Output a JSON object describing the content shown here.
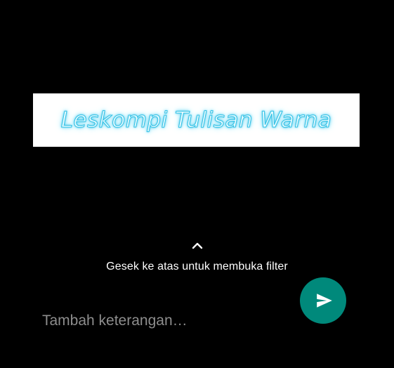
{
  "media_preview": {
    "text": "Leskompi Tulisan Warna",
    "text_color": "#38c3e6",
    "background": "#ffffff"
  },
  "swipe_hint": {
    "icon": "chevron-up-icon",
    "label": "Gesek ke atas untuk membuka filter"
  },
  "caption": {
    "placeholder": "Tambah keterangan…",
    "value": ""
  },
  "send_button": {
    "icon": "send-icon",
    "color": "#00897b"
  }
}
